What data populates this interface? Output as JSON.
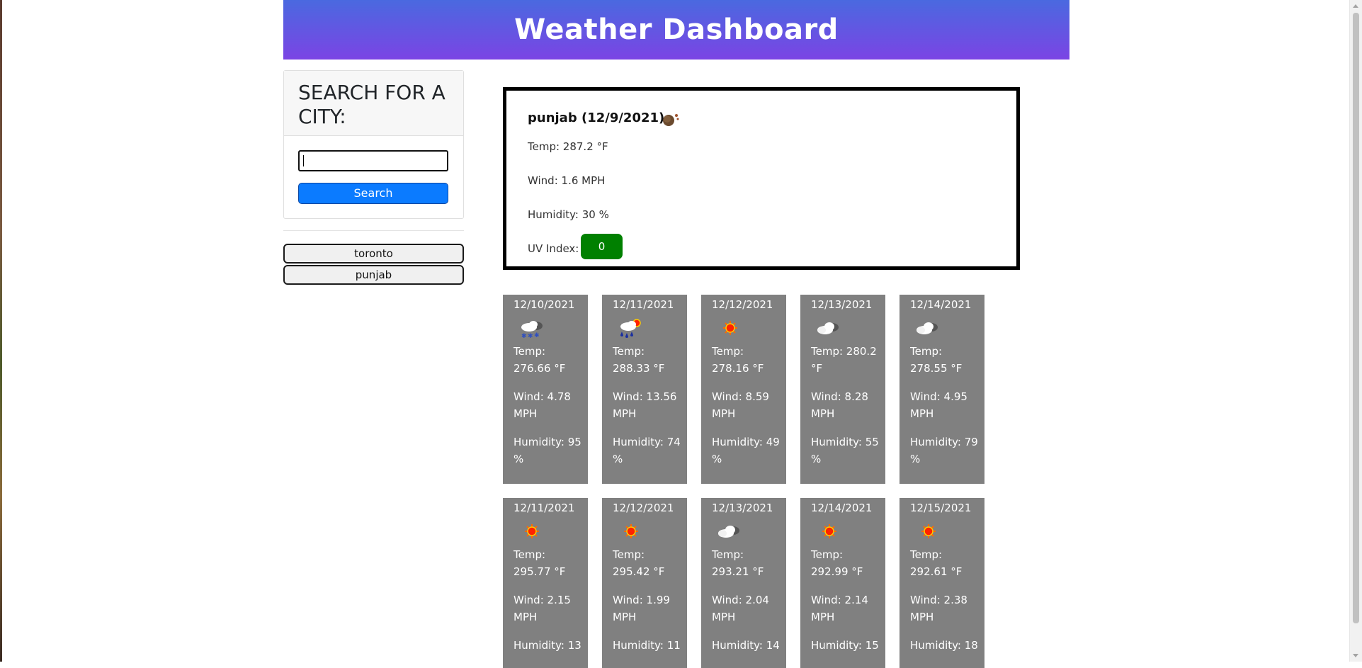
{
  "header": {
    "title": "Weather Dashboard"
  },
  "search": {
    "heading": "SEARCH FOR A CITY:",
    "input_value": "",
    "button_label": "Search",
    "button_color": "#0b7bff"
  },
  "history": [
    "toronto",
    "punjab"
  ],
  "current": {
    "title": "punjab (12/9/2021)",
    "icon": "moon-cloud-icon",
    "temp": "Temp: 287.2 °F",
    "wind": "Wind: 1.6 MPH",
    "humidity": "Humidity: 30 %",
    "uv_label": "UV Index:",
    "uv_value": "0",
    "uv_color": "#008000"
  },
  "forecast_rows": [
    [
      {
        "date": "12/10/2021",
        "icon": "snow-cloud-icon",
        "temp": "Temp: 276.66 °F",
        "wind": "Wind: 4.78 MPH",
        "humidity": "Humidity: 95 %"
      },
      {
        "date": "12/11/2021",
        "icon": "rain-sun-icon",
        "temp": "Temp: 288.33 °F",
        "wind": "Wind: 13.56 MPH",
        "humidity": "Humidity: 74 %"
      },
      {
        "date": "12/12/2021",
        "icon": "sun-icon",
        "temp": "Temp: 278.16 °F",
        "wind": "Wind: 8.59 MPH",
        "humidity": "Humidity: 49 %"
      },
      {
        "date": "12/13/2021",
        "icon": "cloud-icon",
        "temp": "Temp: 280.2 °F",
        "wind": "Wind: 8.28 MPH",
        "humidity": "Humidity: 55 %"
      },
      {
        "date": "12/14/2021",
        "icon": "cloud-icon",
        "temp": "Temp: 278.55 °F",
        "wind": "Wind: 4.95 MPH",
        "humidity": "Humidity: 79 %"
      }
    ],
    [
      {
        "date": "12/11/2021",
        "icon": "sun-icon",
        "temp": "Temp: 295.77 °F",
        "wind": "Wind: 2.15 MPH",
        "humidity": "Humidity: 13"
      },
      {
        "date": "12/12/2021",
        "icon": "sun-icon",
        "temp": "Temp: 295.42 °F",
        "wind": "Wind: 1.99 MPH",
        "humidity": "Humidity: 11"
      },
      {
        "date": "12/13/2021",
        "icon": "cloud-icon",
        "temp": "Temp: 293.21 °F",
        "wind": "Wind: 2.04 MPH",
        "humidity": "Humidity: 14"
      },
      {
        "date": "12/14/2021",
        "icon": "sun-icon",
        "temp": "Temp: 292.99 °F",
        "wind": "Wind: 2.14 MPH",
        "humidity": "Humidity: 15"
      },
      {
        "date": "12/15/2021",
        "icon": "sun-icon",
        "temp": "Temp: 292.61 °F",
        "wind": "Wind: 2.38 MPH",
        "humidity": "Humidity: 18"
      }
    ]
  ],
  "forecast_card_color": "#808080"
}
